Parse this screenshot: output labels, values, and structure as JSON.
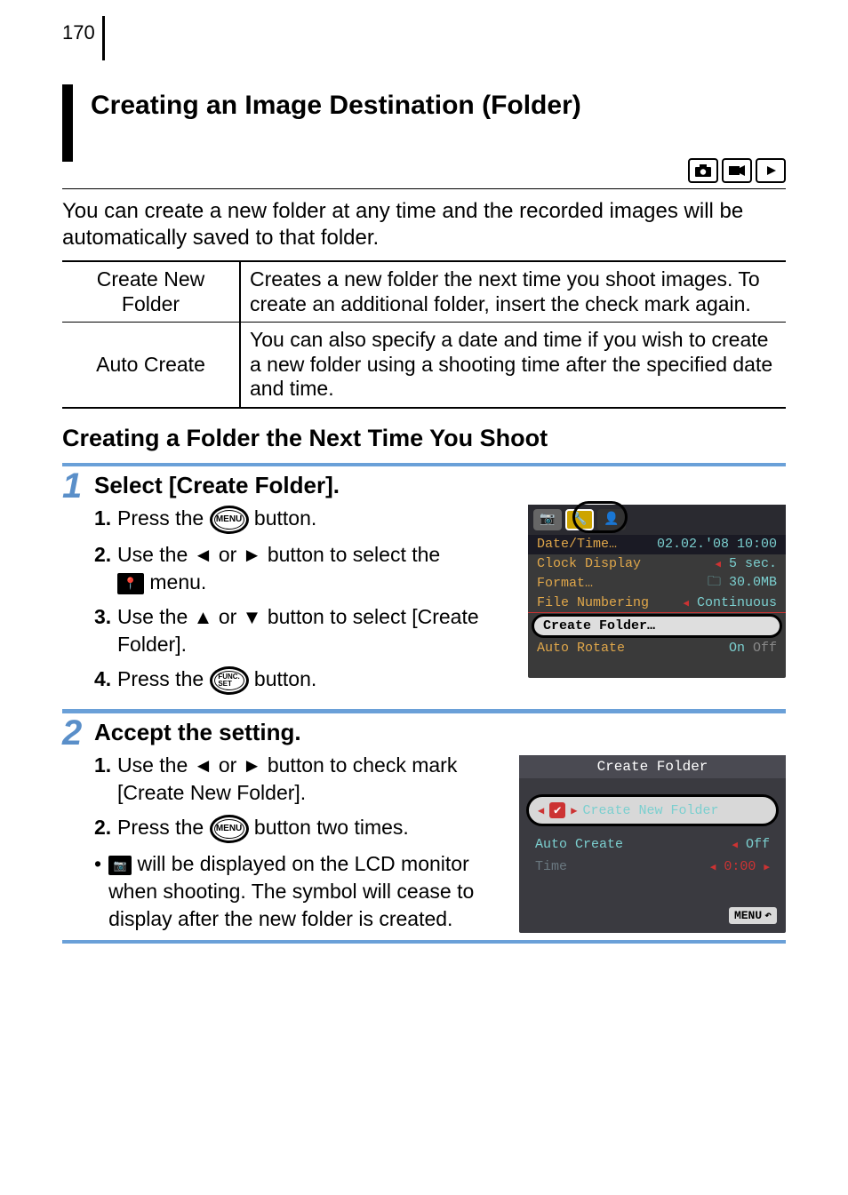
{
  "page_number": "170",
  "section_title": "Creating an Image Destination (Folder)",
  "intro": "You can create a new folder at any time and the recorded images will be automatically saved to that folder.",
  "defs": [
    {
      "term_l1": "Create New",
      "term_l2": "Folder",
      "def": "Creates a new folder the next time you shoot images. To create an additional folder, insert the check mark again."
    },
    {
      "term_l1": "Auto Create",
      "term_l2": "",
      "def": "You can also specify a date and time if you wish to create a new folder using a shooting time after the specified date and time."
    }
  ],
  "sub_heading": "Creating a Folder the Next Time You Shoot",
  "steps": [
    {
      "num": "1",
      "title": "Select [Create Folder].",
      "items": [
        {
          "n": "1.",
          "pre": "Press the ",
          "btn": "MENU",
          "post": " button."
        },
        {
          "n": "2.",
          "pre": "Use the ",
          "mid": " or ",
          "post": " button to select the ",
          "trail": " menu.",
          "arrows": [
            "◄",
            "►"
          ],
          "icon": "tools"
        },
        {
          "n": "3.",
          "pre": "Use the ",
          "mid": " or ",
          "post": " button to select [Create Folder].",
          "arrows": [
            "▲",
            "▼"
          ]
        },
        {
          "n": "4.",
          "pre": "Press the ",
          "btn": "FUNC.\nSET",
          "post": " button."
        }
      ],
      "shot": {
        "rows": [
          {
            "l": "Date/Time…",
            "r": "02.02.'08 10:00",
            "rc": "teal"
          },
          {
            "l": "Clock Display",
            "r": "5 sec.",
            "rc": "teal",
            "tri": true
          },
          {
            "l": "Format…",
            "r": "30.0MB",
            "rc": "teal",
            "icon": true
          },
          {
            "l": "File Numbering",
            "r": "Continuous",
            "rc": "teal",
            "tri": true,
            "ul": true
          }
        ],
        "sel": "Create Folder…",
        "last": {
          "l": "Auto Rotate",
          "on": "On",
          "off": "Off"
        }
      }
    },
    {
      "num": "2",
      "title": "Accept the setting.",
      "items": [
        {
          "n": "1.",
          "pre": "Use the ",
          "mid": " or ",
          "post": " button to check mark [Create New Folder].",
          "arrows": [
            "◄",
            "►"
          ]
        },
        {
          "n": "2.",
          "pre": "Press the ",
          "btn": "MENU",
          "post": " button two times."
        }
      ],
      "bullet_pre": " will be displayed on the LCD monitor when shooting. The symbol will cease to display after the new folder is created.",
      "shot": {
        "title": "Create Folder",
        "cnf": "Create New Folder",
        "r2": {
          "l": "Auto Create",
          "r": "Off"
        },
        "r3": {
          "l": "Time",
          "r": "0:00"
        },
        "menu": "MENU"
      }
    }
  ]
}
